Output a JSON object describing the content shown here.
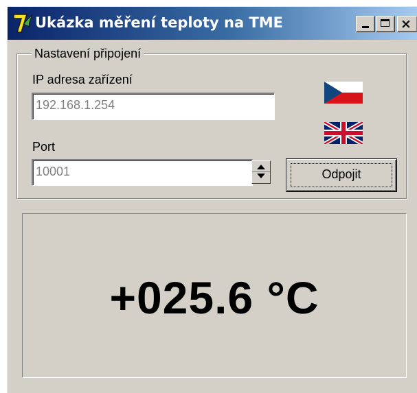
{
  "window": {
    "title": "Ukázka měření teploty na TME",
    "icon": "app-logo-icon",
    "controls": {
      "minimize": "minimize-icon",
      "maximize": "maximize-icon",
      "close": "×"
    }
  },
  "connection": {
    "group_label": "Nastavení připojení",
    "ip_label": "IP adresa zařízení",
    "ip_value": "192.168.1.254",
    "port_label": "Port",
    "port_value": "10001",
    "disconnect_label": "Odpojit",
    "flags": [
      "czech-flag-icon",
      "uk-flag-icon"
    ]
  },
  "reading": {
    "temperature": "+025.6 °C"
  },
  "colors": {
    "title_gradient_start": "#0a246a",
    "title_gradient_end": "#a6caf0",
    "window_bg": "#d4d0c8",
    "disabled_text": "#808080"
  }
}
